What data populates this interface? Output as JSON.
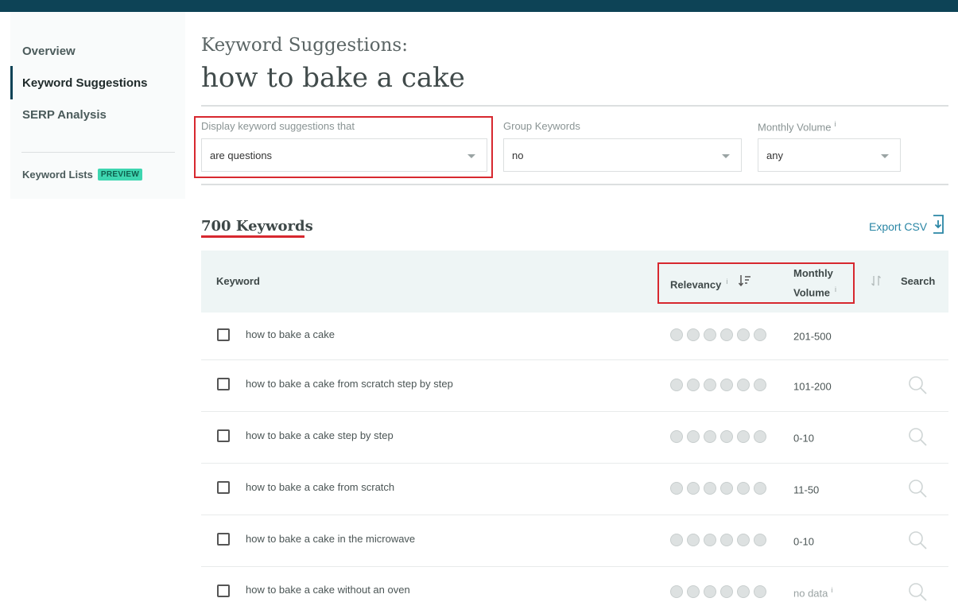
{
  "sidebar": {
    "items": [
      {
        "label": "Overview"
      },
      {
        "label": "Keyword Suggestions"
      },
      {
        "label": "SERP Analysis"
      }
    ],
    "keyword_lists": {
      "label": "Keyword Lists",
      "badge": "PREVIEW"
    }
  },
  "header": {
    "subtitle": "Keyword Suggestions:",
    "query": "how to bake a cake"
  },
  "filters": {
    "display": {
      "label": "Display keyword suggestions that",
      "value": "are questions"
    },
    "group": {
      "label": "Group Keywords",
      "value": "no"
    },
    "volume": {
      "label": "Monthly Volume",
      "info": "i",
      "value": "any"
    }
  },
  "results": {
    "count": "700 Keywords",
    "export_label": "Export CSV"
  },
  "table": {
    "headers": {
      "keyword": "Keyword",
      "relevancy": "Relevancy",
      "relevancy_info": "i",
      "volume_line1": "Monthly",
      "volume_line2": "Volume",
      "volume_info": "i",
      "search": "Search"
    },
    "rows": [
      {
        "keyword": "how to bake a cake",
        "volume": "201-500",
        "info": ""
      },
      {
        "keyword": "how to bake a cake from scratch step by step",
        "volume": "101-200",
        "info": ""
      },
      {
        "keyword": "how to bake a cake step by step",
        "volume": "0-10",
        "info": ""
      },
      {
        "keyword": "how to bake a cake from scratch",
        "volume": "11-50",
        "info": ""
      },
      {
        "keyword": "how to bake a cake in the microwave",
        "volume": "0-10",
        "info": ""
      },
      {
        "keyword": "how to bake a cake without an oven",
        "volume": "no data",
        "info": "i"
      }
    ]
  },
  "colors": {
    "topbar": "#0d4356",
    "highlight": "#d7282f",
    "badge": "#3ed6b0",
    "link": "#2a86a5"
  }
}
